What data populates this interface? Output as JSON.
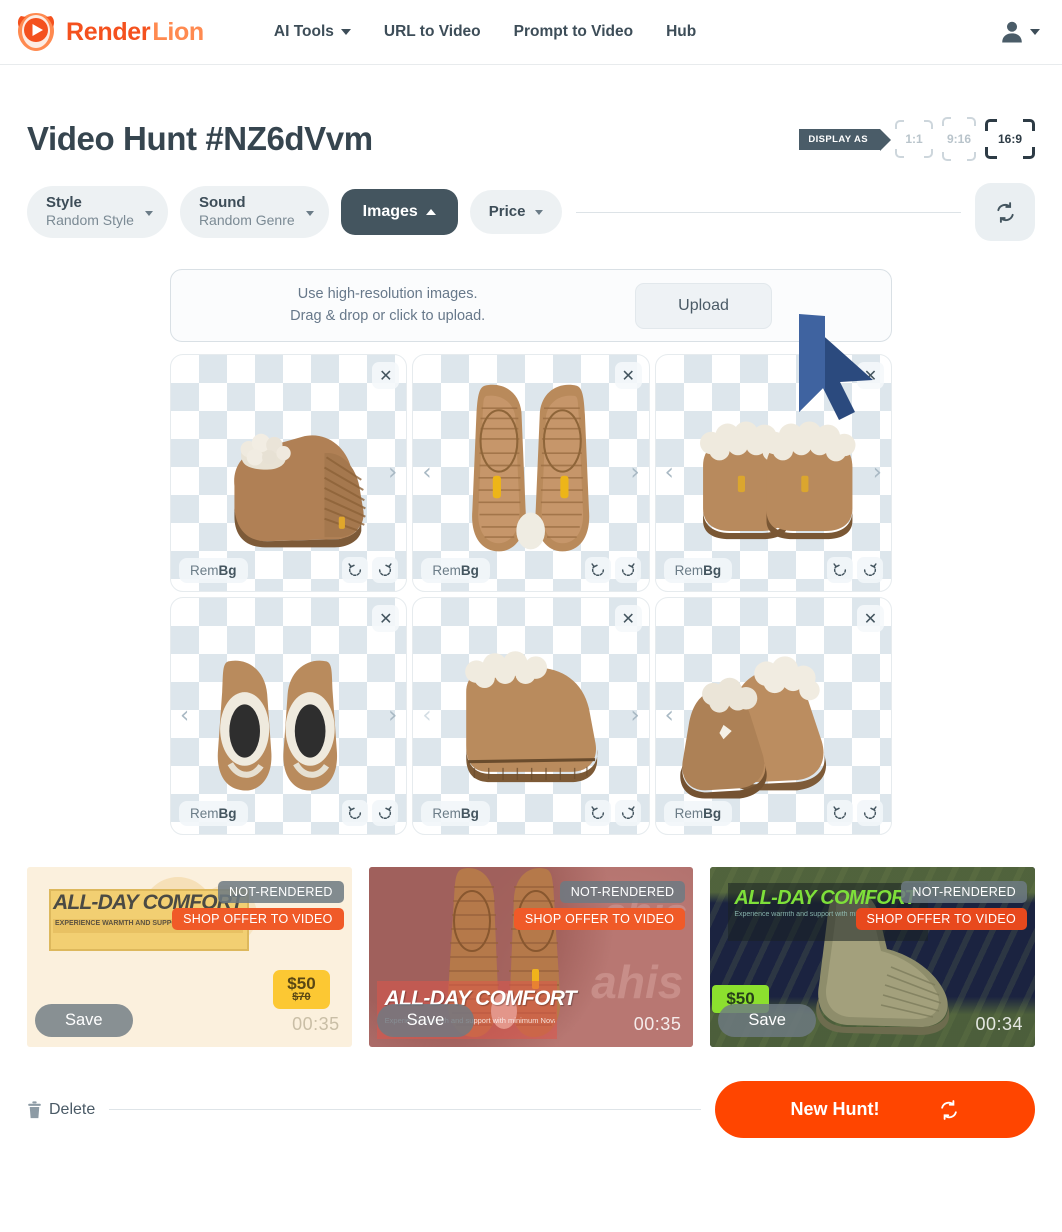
{
  "brand": {
    "name_part1": "Render",
    "name_part2": "Lion",
    "logo_icon": "lion-play-logo",
    "color_primary": "#F4511E",
    "color_secondary": "#FF8A50"
  },
  "nav": {
    "items": [
      {
        "label": "AI Tools",
        "has_dropdown": true
      },
      {
        "label": "URL to Video",
        "has_dropdown": false
      },
      {
        "label": "Prompt to Video",
        "has_dropdown": false
      },
      {
        "label": "Hub",
        "has_dropdown": false
      }
    ],
    "account_icon": "user-icon",
    "account_caret_icon": "chevron-down-icon"
  },
  "header": {
    "title": "Video Hunt #NZ6dVvm",
    "display_as_label": "DISPLAY AS",
    "ratios": [
      {
        "label": "1:1",
        "active": false
      },
      {
        "label": "9:16",
        "active": false
      },
      {
        "label": "16:9",
        "active": true
      }
    ]
  },
  "filters": {
    "style": {
      "label": "Style",
      "value": "Random Style"
    },
    "sound": {
      "label": "Sound",
      "value": "Random Genre"
    },
    "images": {
      "label": "Images",
      "active": true
    },
    "price": {
      "label": "Price"
    },
    "refresh_icon": "refresh-icon"
  },
  "upload": {
    "line1": "Use high-resolution images.",
    "line2": "Drag & drop or click to upload.",
    "button_label": "Upload"
  },
  "image_cards": [
    {
      "rembg_prefix": "Rem",
      "rembg_suffix": "Bg",
      "alt": "tan-sheepskin-boot-side-view",
      "close_label": "✕",
      "prev": "‹",
      "next": "›",
      "show_prev": false,
      "show_next": true
    },
    {
      "rembg_prefix": "Rem",
      "rembg_suffix": "Bg",
      "alt": "boot-soles-pair-bottom-view",
      "close_label": "✕",
      "prev": "‹",
      "next": "›",
      "show_prev": true,
      "show_next": true
    },
    {
      "rembg_prefix": "Rem",
      "rembg_suffix": "Bg",
      "alt": "pair-of-tan-boots-front-view",
      "close_label": "✕",
      "prev": "‹",
      "next": "›",
      "show_prev": true,
      "show_next": true
    },
    {
      "rembg_prefix": "Rem",
      "rembg_suffix": "Bg",
      "alt": "boots-top-down-view",
      "close_label": "✕",
      "prev": "‹",
      "next": "›",
      "show_prev": true,
      "show_next": true
    },
    {
      "rembg_prefix": "Rem",
      "rembg_suffix": "Bg",
      "alt": "single-boot-side-profile",
      "close_label": "✕",
      "prev": "‹",
      "next": "›",
      "show_prev": true,
      "show_next": true
    },
    {
      "rembg_prefix": "Rem",
      "rembg_suffix": "Bg",
      "alt": "pair-of-boots-angled-view",
      "close_label": "✕",
      "prev": "‹",
      "next": "›",
      "show_prev": true,
      "show_next": false
    }
  ],
  "rotate_icons": {
    "left": "rotate-left-icon",
    "right": "rotate-right-icon"
  },
  "videos": [
    {
      "status_badge": "NOT-RENDERED",
      "shop_badge": "SHOP OFFER TO VIDEO",
      "headline": "ALL-DAY COMFORT",
      "subline": "EXPERIENCE WARMTH AND SUPPORT WITH MINIMUM NOVA BOOT.",
      "price": "$50",
      "price_old": "$70",
      "save_label": "Save",
      "duration": "00:35",
      "bg_color": "#fbf0dd",
      "headline_color": "#4a4a44",
      "banner_color": "#f2cf72",
      "price_bg": "#fcc833"
    },
    {
      "status_badge": "NOT-RENDERED",
      "shop_badge": "SHOP OFFER TO VIDEO",
      "headline": "ALL-DAY COMFORT",
      "subline": "Experience warmth and support with minimum Nova Boot.",
      "price": "",
      "price_old": "",
      "save_label": "Save",
      "duration": "00:35",
      "bg_color": "#b0706d",
      "headline_color": "#ffffff",
      "banner_color": "rgba(225,80,70,0.55)",
      "price_bg": ""
    },
    {
      "status_badge": "NOT-RENDERED",
      "shop_badge": "SHOP OFFER TO VIDEO",
      "headline": "ALL-DAY COMFORT",
      "subline": "Experience warmth and support with minimum Nova Boot.",
      "price": "$50",
      "price_old": "",
      "save_label": "Save",
      "duration": "00:34",
      "bg_color": "#1b2340",
      "headline_color": "#7ee03a",
      "banner_color": "rgba(30,40,40,0.55)",
      "price_bg": "#8ce02e"
    }
  ],
  "bottom": {
    "delete_label": "Delete",
    "delete_icon": "trash-icon",
    "new_hunt_label": "New Hunt!",
    "new_hunt_icon": "refresh-icon",
    "new_hunt_color": "#FF4500"
  },
  "cursor": {
    "icon": "mouse-pointer-cursor",
    "color": "#2b4a7e"
  }
}
